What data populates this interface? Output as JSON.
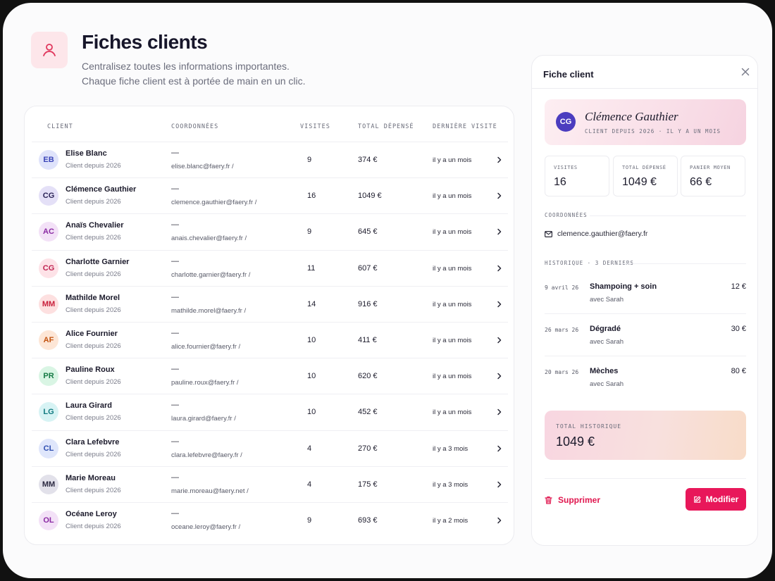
{
  "header": {
    "title": "Fiches clients",
    "subtitle_line1": "Centralisez toutes les informations importantes.",
    "subtitle_line2": "Chaque fiche client est à portée de main en un clic.",
    "icon": "user-icon"
  },
  "table": {
    "columns": [
      "CLIENT",
      "COORDONNÉES",
      "VISITES",
      "TOTAL DÉPENSÉ",
      "DERNIÈRE VISITE"
    ],
    "rows": [
      {
        "initials": "EB",
        "name": "Elise Blanc",
        "since": "Client depuis 2026",
        "phone": "—",
        "email": "elise.blanc@faery.fr /",
        "visits": "9",
        "total": "374 €",
        "last": "il y a un mois"
      },
      {
        "initials": "CG",
        "name": "Clémence Gauthier",
        "since": "Client depuis 2026",
        "phone": "—",
        "email": "clemence.gauthier@faery.fr /",
        "visits": "16",
        "total": "1049 €",
        "last": "il y a un mois"
      },
      {
        "initials": "AC",
        "name": "Anaïs Chevalier",
        "since": "Client depuis 2026",
        "phone": "—",
        "email": "anais.chevalier@faery.fr /",
        "visits": "9",
        "total": "645 €",
        "last": "il y a un mois"
      },
      {
        "initials": "CG",
        "name": "Charlotte Garnier",
        "since": "Client depuis 2026",
        "phone": "—",
        "email": "charlotte.garnier@faery.fr /",
        "visits": "11",
        "total": "607 €",
        "last": "il y a un mois"
      },
      {
        "initials": "MM",
        "name": "Mathilde Morel",
        "since": "Client depuis 2026",
        "phone": "—",
        "email": "mathilde.morel@faery.fr /",
        "visits": "14",
        "total": "916 €",
        "last": "il y a un mois"
      },
      {
        "initials": "AF",
        "name": "Alice Fournier",
        "since": "Client depuis 2026",
        "phone": "—",
        "email": "alice.fournier@faery.fr /",
        "visits": "10",
        "total": "411 €",
        "last": "il y a un mois"
      },
      {
        "initials": "PR",
        "name": "Pauline Roux",
        "since": "Client depuis 2026",
        "phone": "—",
        "email": "pauline.roux@faery.fr /",
        "visits": "10",
        "total": "620 €",
        "last": "il y a un mois"
      },
      {
        "initials": "LG",
        "name": "Laura Girard",
        "since": "Client depuis 2026",
        "phone": "—",
        "email": "laura.girard@faery.fr /",
        "visits": "10",
        "total": "452 €",
        "last": "il y a un mois"
      },
      {
        "initials": "CL",
        "name": "Clara Lefebvre",
        "since": "Client depuis 2026",
        "phone": "—",
        "email": "clara.lefebvre@faery.fr /",
        "visits": "4",
        "total": "270 €",
        "last": "il y a 3 mois"
      },
      {
        "initials": "MM",
        "name": "Marie Moreau",
        "since": "Client depuis 2026",
        "phone": "—",
        "email": "marie.moreau@faery.net /",
        "visits": "4",
        "total": "175 €",
        "last": "il y a 3 mois"
      },
      {
        "initials": "OL",
        "name": "Océane Leroy",
        "since": "Client depuis 2026",
        "phone": "—",
        "email": "oceane.leroy@faery.fr /",
        "visits": "9",
        "total": "693 €",
        "last": "il y a 2 mois"
      }
    ],
    "avatar_colors": [
      {
        "bg": "#dfe3fb",
        "fg": "#3b45b8"
      },
      {
        "bg": "#e4e0f7",
        "fg": "#2c2558"
      },
      {
        "bg": "#f3e1f7",
        "fg": "#8a2aa3"
      },
      {
        "bg": "#fde2e7",
        "fg": "#c02452"
      },
      {
        "bg": "#fde0e0",
        "fg": "#c81e3a"
      },
      {
        "bg": "#fde6d6",
        "fg": "#c2520f"
      },
      {
        "bg": "#d9f5e4",
        "fg": "#167a45"
      },
      {
        "bg": "#d7f3f4",
        "fg": "#117a80"
      },
      {
        "bg": "#dfe6fb",
        "fg": "#2f4fb0"
      },
      {
        "bg": "#e2e1ea",
        "fg": "#2a2840"
      },
      {
        "bg": "#f3e1f7",
        "fg": "#8a2aa3"
      }
    ],
    "chevron_icon": "chevron-right-icon"
  },
  "panel": {
    "title": "Fiche client",
    "close_icon": "close-icon",
    "client": {
      "initials": "CG",
      "name": "Clémence Gauthier",
      "subtitle": "CLIENT DEPUIS 2026 · IL Y A UN MOIS"
    },
    "stats": [
      {
        "label": "VISITES",
        "value": "16"
      },
      {
        "label": "TOTAL DÉPENSÉ",
        "value": "1049 €"
      },
      {
        "label": "PANIER MOYEN",
        "value": "66 €"
      }
    ],
    "contact_label": "COORDONNÉES",
    "email": "clemence.gauthier@faery.fr",
    "email_icon": "mail-icon",
    "history_label": "HISTORIQUE · 3 DERNIERS",
    "history": [
      {
        "date": "9 avril 26",
        "service": "Shampoing + soin",
        "with": "avec Sarah",
        "price": "12 €"
      },
      {
        "date": "26 mars 26",
        "service": "Dégradé",
        "with": "avec Sarah",
        "price": "30 €"
      },
      {
        "date": "20 mars 26",
        "service": "Mèches",
        "with": "avec Sarah",
        "price": "80 €"
      }
    ],
    "total_label": "TOTAL HISTORIQUE",
    "total_value": "1049 €",
    "delete_label": "Supprimer",
    "delete_icon": "trash-icon",
    "edit_label": "Modifier",
    "edit_icon": "edit-icon",
    "accent_color": "#e8175a"
  }
}
